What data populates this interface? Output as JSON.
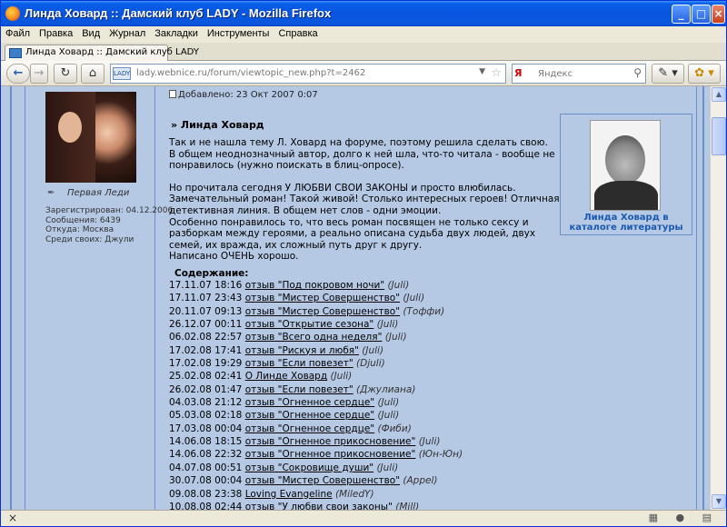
{
  "window": {
    "title": "Линда Ховард :: Дамский клуб LADY - Mozilla Firefox",
    "min": "_",
    "max": "□",
    "close": "×"
  },
  "menu": [
    "Файл",
    "Правка",
    "Вид",
    "Журнал",
    "Закладки",
    "Инструменты",
    "Справка"
  ],
  "tab": {
    "label": "Линда Ховард :: Дамский клуб LADY"
  },
  "nav": {
    "url": "lady.webnice.ru/forum/viewtopic_new.php?t=2462",
    "site_badge": "LADY",
    "search_placeholder": "Яндекс",
    "search_engine": "Я",
    "back": "←",
    "forward": "→",
    "reload": "↻",
    "home": "⌂",
    "star": "☆",
    "dropdown": "▼",
    "magnifier": "⚲",
    "tool1": "✎ ▾",
    "tool2": "✿ ▾"
  },
  "user": {
    "rank": "Первая Леди",
    "registered": "Зарегистрирован: 04.12.2006",
    "messages": "Сообщения: 6439",
    "from": "Откуда: Москва",
    "among": "Среди своих: Джули"
  },
  "post": {
    "posted": "Добавлено: 23 Окт 2007 0:07",
    "author": "» Линда Ховард",
    "paragraphs": [
      [
        "Так и не нашла тему Л. Ховард на форуме, поэтому решила сделать свою.",
        "В общем неоднозначный автор, долго к ней шла, что-то читала - вообще не",
        "понравилось (нужно поискать в блиц-опросе)."
      ],
      [
        "Но прочитала сегодня У ЛЮБВИ СВОИ ЗАКОНЫ и просто влюбилась.",
        "Замечательный роман! Такой живой! Столько интересных героев! Отличная",
        "детективная линия. В общем нет слов - одни эмоции.",
        "Особенно понравилось то, что весь роман посвящен не только сексу и",
        "разборкам между героями, а реально описана судьба двух людей, двух",
        "семей, их вражда, их сложный путь друг к другу.",
        "Написано ОЧЕНЬ хорошо."
      ]
    ]
  },
  "catalog": {
    "caption": "Линда Ховард в каталоге литературы"
  },
  "toc": {
    "title": "Содержание:",
    "rows": [
      {
        "date": "17.11.07 18:16",
        "link": "отзыв \"Под покровом ночи\"",
        "by": "(Juli)"
      },
      {
        "date": "17.11.07 23:43",
        "link": "отзыв \"Мистер Совершенство\"",
        "by": "(Juli)"
      },
      {
        "date": "20.11.07 09:13",
        "link": "отзыв \"Мистер Совершенство\"",
        "by": "(Тоффи)"
      },
      {
        "date": "26.12.07 00:11",
        "link": "отзыв \"Открытие сезона\"",
        "by": "(Juli)"
      },
      {
        "date": "06.02.08 22:57",
        "link": "отзыв \"Всего одна неделя\"",
        "by": "(Juli)"
      },
      {
        "date": "17.02.08 17:41",
        "link": "отзыв \"Рискуя и любя\"",
        "by": "(Juli)"
      },
      {
        "date": "17.02.08 19:29",
        "link": "отзыв \"Если повезет\"",
        "by": "(Djuli)"
      },
      {
        "date": "25.02.08 02:41",
        "link": "О Линде Ховард",
        "by": "(Juli)"
      },
      {
        "date": "26.02.08 01:47",
        "link": "отзыв \"Если повезет\"",
        "by": "(Джулиана)"
      },
      {
        "date": "04.03.08 21:12",
        "link": "отзыв \"Огненное сердце\"",
        "by": "(Juli)"
      },
      {
        "date": "05.03.08 02:18",
        "link": "отзыв \"Огненное сердце\"",
        "by": "(Juli)"
      },
      {
        "date": "17.03.08 00:04",
        "link": "отзыв \"Огненное сердце\"",
        "by": "(Фиби)"
      },
      {
        "date": "14.06.08 18:15",
        "link": "отзыв \"Огненное прикосновение\"",
        "by": "(Juli)"
      },
      {
        "date": "14.06.08 22:32",
        "link": "отзыв \"Огненное прикосновение\"",
        "by": "(Юн-Юн)"
      },
      {
        "date": "04.07.08 00:51",
        "link": "отзыв \"Сокровище души\"",
        "by": "(Juli)"
      },
      {
        "date": "30.07.08 00:04",
        "link": "отзыв \"Мистер Совершенство\"",
        "by": "(Apрel)"
      },
      {
        "date": "09.08.08 23:38",
        "link": "Loving Evangeline",
        "by": "(MiledY)"
      },
      {
        "date": "10.08.08 02:44",
        "link": "отзыв \"У любви свои законы\"",
        "by": "(Mill)"
      }
    ]
  },
  "scroll": {
    "up": "▲",
    "down": "▼",
    "position": 0.08
  },
  "status": {
    "close": "×",
    "icons": "▦ ● ▤"
  }
}
